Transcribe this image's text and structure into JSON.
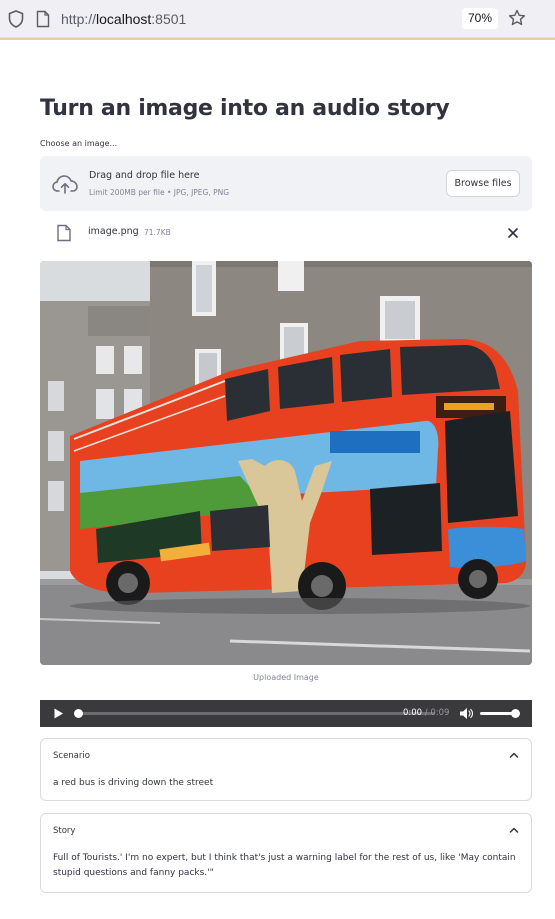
{
  "browser": {
    "url_prefix": "http://",
    "url_host": "localhost",
    "url_port": ":8501",
    "zoom": "70%",
    "icons": [
      "shield-icon",
      "page-icon",
      "star-icon"
    ]
  },
  "page": {
    "title": "Turn an image into an audio story"
  },
  "uploader": {
    "label": "Choose an image...",
    "dropzone_title": "Drag and drop file here",
    "dropzone_subtitle": "Limit 200MB per file • JPG, JPEG, PNG",
    "browse_label": "Browse files",
    "file": {
      "name": "image.png",
      "size": "71.7KB"
    }
  },
  "image": {
    "caption": "Uploaded Image"
  },
  "audio": {
    "current_time": "0:00",
    "separator": " / ",
    "duration": "0:09",
    "progress": 0,
    "volume": 1
  },
  "expanders": {
    "scenario": {
      "label": "Scenario",
      "text": "a red bus is driving down the street"
    },
    "story": {
      "label": "Story",
      "text": "Full of Tourists.' I'm no expert, but I think that's just a warning label for the rest of us, like 'May contain stupid questions and fanny packs.'\""
    }
  },
  "colors": {
    "accent": "#ff4b4b",
    "text": "#31333f",
    "muted": "#808495",
    "dropzone_bg": "#f0f2f6",
    "audio_bg": "#3a3a3c"
  }
}
